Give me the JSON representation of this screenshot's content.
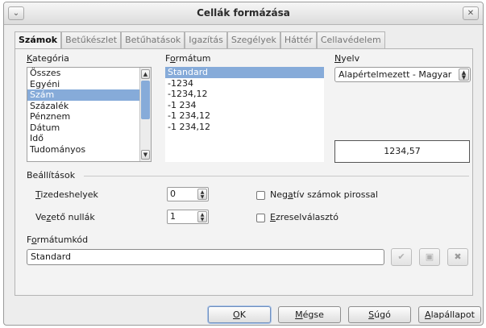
{
  "window": {
    "title": "Cellák formázása",
    "menu_glyph": "⌄",
    "close_glyph": "✕"
  },
  "tabs": [
    {
      "label": "Számok",
      "active": true
    },
    {
      "label": "Betűkészlet",
      "active": false
    },
    {
      "label": "Betűhatások",
      "active": false
    },
    {
      "label": "Igazítás",
      "active": false
    },
    {
      "label": "Szegélyek",
      "active": false
    },
    {
      "label": "Háttér",
      "active": false
    },
    {
      "label": "Cellavédelem",
      "active": false
    }
  ],
  "category": {
    "label_underlined": "K",
    "label_rest": "ategória",
    "items": [
      "Összes",
      "Egyéni",
      "Szám",
      "Százalék",
      "Pénznem",
      "Dátum",
      "Idő",
      "Tudományos"
    ],
    "selected": "Szám"
  },
  "format": {
    "label_pre": "F",
    "label_underlined": "o",
    "label_rest": "rmátum",
    "items": [
      "Standard",
      "-1234",
      "-1234,12",
      "-1 234",
      "-1 234,12",
      "-1 234,12"
    ],
    "selected": "Standard"
  },
  "language": {
    "label_underlined": "N",
    "label_rest": "yelv",
    "value": "Alapértelmezett - Magyar"
  },
  "preview_value": "1234,57",
  "options": {
    "section_label": "Beállítások",
    "decimals_label_underlined": "T",
    "decimals_label_rest": "izedeshelyek",
    "decimals_value": "0",
    "leading_zeros_label_pre": "Ve",
    "leading_zeros_label_underlined": "z",
    "leading_zeros_label_rest": "ető nullák",
    "leading_zeros_value": "1",
    "negative_red_label_pre": "Neg",
    "negative_red_label_underlined": "a",
    "negative_red_label_rest": "tív számok pirossal",
    "negative_red_checked": false,
    "thousands_sep_label_underlined": "E",
    "thousands_sep_label_rest": "zreselválasztó",
    "thousands_sep_checked": false
  },
  "format_code": {
    "label_pre": "F",
    "label_underlined": "o",
    "label_rest": "rmátumkód",
    "value": "Standard",
    "icons": [
      "check-icon",
      "add-icon",
      "delete-icon"
    ]
  },
  "buttons": {
    "ok_underlined": "O",
    "ok_rest": "K",
    "cancel_underlined": "M",
    "cancel_rest": "égse",
    "help_underlined": "S",
    "help_rest": "úgó",
    "reset_underlined": "A",
    "reset_rest": "lapállapot"
  }
}
